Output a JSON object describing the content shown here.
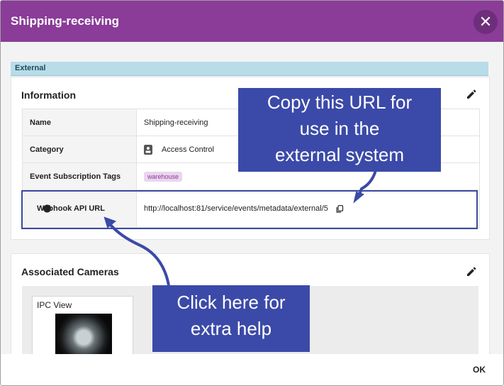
{
  "dialog": {
    "title": "Shipping-receiving",
    "close_label": "✕",
    "ok_label": "OK"
  },
  "section_tag": "External",
  "information": {
    "title": "Information",
    "rows": {
      "name": {
        "label": "Name",
        "value": "Shipping-receiving"
      },
      "category": {
        "label": "Category",
        "value": "Access Control"
      },
      "tags": {
        "label": "Event Subscription Tags",
        "value": "warehouse"
      },
      "webhook": {
        "label": "Webhook API URL",
        "value": "http://localhost:81/service/events/metadata/external/5",
        "help": "?"
      }
    }
  },
  "cameras": {
    "title": "Associated Cameras",
    "items": [
      {
        "label": "IPC View"
      }
    ]
  },
  "callouts": {
    "copy": [
      "Copy this URL for",
      "use in the",
      "external system"
    ],
    "help": [
      "Click here for",
      "extra help"
    ]
  },
  "colors": {
    "header": "#8a3c98",
    "callout": "#3b4aa8",
    "tag_bg": "#ead5ef",
    "section_bar": "#b8dce8"
  },
  "icons": {
    "close": "close-icon",
    "edit": "pencil-icon",
    "category": "badge-icon",
    "help": "question-circle-icon",
    "copy": "copy-icon"
  }
}
